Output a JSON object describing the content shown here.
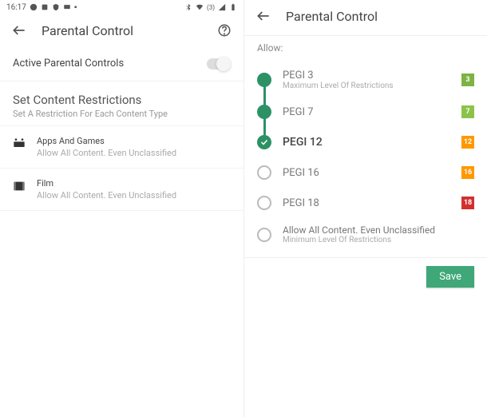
{
  "status": {
    "time": "16:17",
    "signal": "(3)"
  },
  "left": {
    "title": "Parental Control",
    "toggle_label": "Active Parental Controls",
    "section_title": "Set Content Restrictions",
    "section_sub": "Set A Restriction For Each Content Type",
    "rows": [
      {
        "label": "Apps And Games",
        "sub": "Allow All Content. Even Unclassified"
      },
      {
        "label": "Film",
        "sub": "Allow All Content. Even Unclassified"
      }
    ]
  },
  "right": {
    "title": "Parental Control",
    "allow_label": "Allow:",
    "ratings": [
      {
        "label": "PEGI 3",
        "sub": "Maximum Level Of Restrictions",
        "badge": "3"
      },
      {
        "label": "PEGI 7",
        "badge": "7"
      },
      {
        "label": "PEGI 12",
        "badge": "12"
      },
      {
        "label": "PEGI 16",
        "badge": "16"
      },
      {
        "label": "PEGI 18",
        "badge": "18"
      },
      {
        "label": "Allow All Content. Even Unclassified",
        "sub": "Minimum Level Of Restrictions"
      }
    ],
    "save_label": "Save"
  }
}
